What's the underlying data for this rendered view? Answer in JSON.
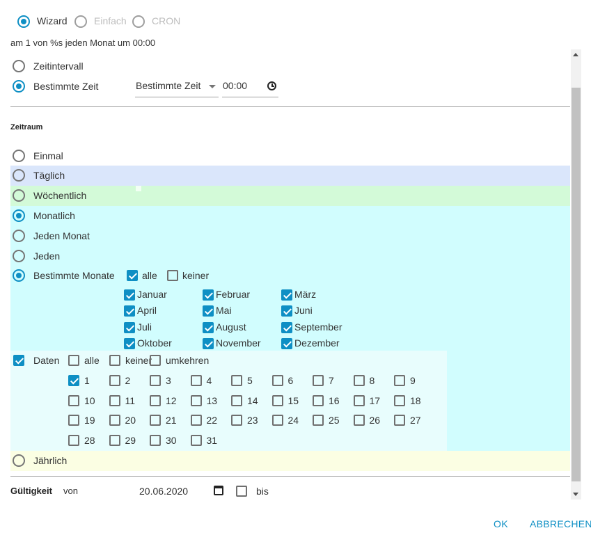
{
  "mode_tabs": [
    {
      "label": "Wizard",
      "selected": true,
      "enabled": true
    },
    {
      "label": "Einfach",
      "selected": false,
      "enabled": false
    },
    {
      "label": "CRON",
      "selected": false,
      "enabled": false
    }
  ],
  "summary_text": "am 1 von %s jeden Monat um 00:00",
  "time_options": {
    "interval_label": "Zeitintervall",
    "specific_label": "Bestimmte Zeit",
    "selected": "Bestimmte Zeit",
    "select_value": "Bestimmte Zeit",
    "time_value": "00:00"
  },
  "period": {
    "heading": "Zeitraum",
    "options": [
      {
        "label": "Einmal",
        "selected": false
      },
      {
        "label": "Täglich",
        "selected": false
      },
      {
        "label": "Wöchentlich",
        "selected": false
      },
      {
        "label": "Monatlich",
        "selected": true
      },
      {
        "label": "Jeden Monat",
        "selected": false
      },
      {
        "label": "Jeden",
        "selected": false
      },
      {
        "label": "Bestimmte Monate",
        "selected": true
      }
    ],
    "yearly_label": "Jährlich"
  },
  "months": {
    "all_label": "alle",
    "all_checked": true,
    "none_label": "keiner",
    "none_checked": false,
    "items": [
      {
        "label": "Januar",
        "checked": true
      },
      {
        "label": "Februar",
        "checked": true
      },
      {
        "label": "März",
        "checked": true
      },
      {
        "label": "April",
        "checked": true
      },
      {
        "label": "Mai",
        "checked": true
      },
      {
        "label": "Juni",
        "checked": true
      },
      {
        "label": "Juli",
        "checked": true
      },
      {
        "label": "August",
        "checked": true
      },
      {
        "label": "September",
        "checked": true
      },
      {
        "label": "Oktober",
        "checked": true
      },
      {
        "label": "November",
        "checked": true
      },
      {
        "label": "Dezember",
        "checked": true
      }
    ]
  },
  "dates": {
    "label": "Daten",
    "checked": true,
    "all_label": "alle",
    "none_label": "keiner",
    "invert_label": "umkehren",
    "checked_days": [
      "1"
    ],
    "days": [
      "1",
      "2",
      "3",
      "4",
      "5",
      "6",
      "7",
      "8",
      "9",
      "10",
      "11",
      "12",
      "13",
      "14",
      "15",
      "16",
      "17",
      "18",
      "19",
      "20",
      "21",
      "22",
      "23",
      "24",
      "25",
      "26",
      "27",
      "28",
      "29",
      "30",
      "31"
    ]
  },
  "validity": {
    "label": "Gültigkeit",
    "from_label": "von",
    "from_value": "20.06.2020",
    "to_label": "bis",
    "to_checked": false
  },
  "actions": {
    "ok_label": "OK",
    "cancel_label": "ABBRECHEN"
  },
  "colors": {
    "accent": "#0e8fc4",
    "daily_band": "#dae6fb",
    "weekly_band": "#d3fad8",
    "monthly_band": "#d1fdfe",
    "dates_band": "#e8fdfd",
    "yearly_band": "#fbfee3"
  }
}
